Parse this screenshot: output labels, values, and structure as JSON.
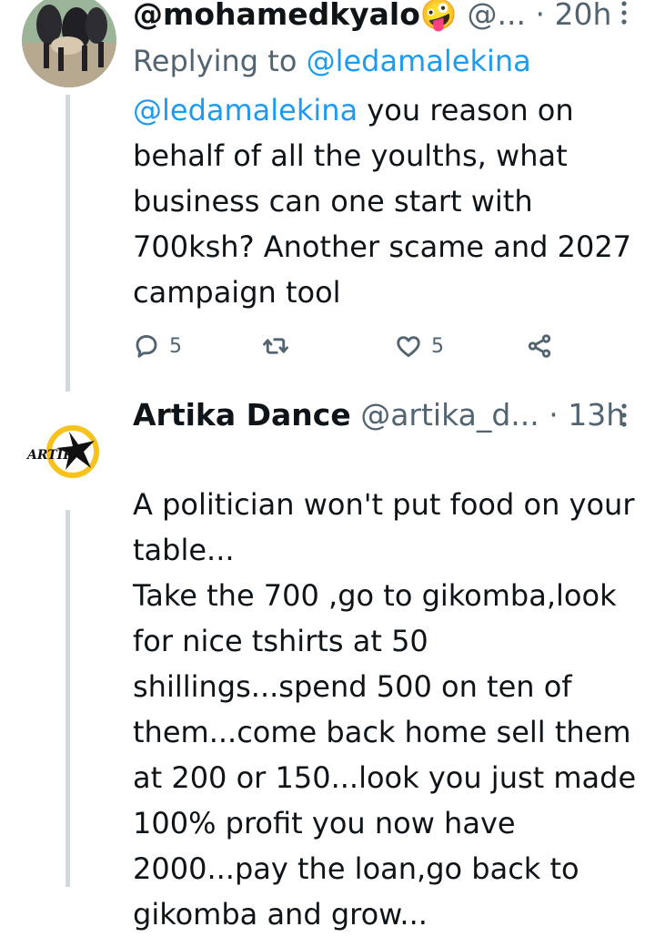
{
  "tweets": [
    {
      "display_name": "@mohamedkyalo",
      "emoji": "🤪",
      "handle": "@...",
      "separator": "·",
      "time": "20h",
      "replying_prefix": "Replying to ",
      "replying_to": "@ledamalekina",
      "mention": "@ledamalekina",
      "text": " you reason on behalf of all the youlths, what business can one start with 700ksh? Another scame and 2027 campaign tool",
      "replies": "5",
      "retweets": "",
      "likes": "5",
      "avatar_icon": "photo-avatar"
    },
    {
      "display_name": "Artika Dance",
      "handle": "@artika_d...",
      "separator": "·",
      "time": "13h",
      "avatar_logo_text": "ARTIKA",
      "text": "A politician won't put food on your table...\nTake the 700 ,go to gikomba,look for nice tshirts at 50 shillings...spend 500 on ten of them...come back home sell them at 200 or 150...look you just made 100% profit you now have 2000...pay the loan,go back to gikomba and grow..."
    }
  ],
  "colors": {
    "text": "#0f1419",
    "secondary": "#536471",
    "link": "#1d9bf0",
    "thread_line": "#cfd9de",
    "logo_yellow": "#f6c21c"
  },
  "icons": [
    "reply-icon",
    "retweet-icon",
    "like-icon",
    "share-icon",
    "more-options-icon"
  ]
}
